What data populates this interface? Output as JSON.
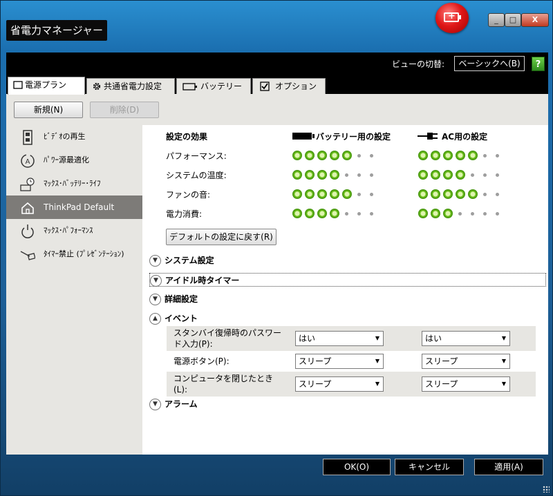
{
  "window": {
    "title": "省電力マネージャー",
    "controls": {
      "minimize": "_",
      "maximize": "□",
      "close": "X"
    }
  },
  "header": {
    "view_label": "ビューの切替:",
    "view_button": "ベーシックへ(B)",
    "help_icon_text": "?"
  },
  "tabs": [
    {
      "label": "電源プラン",
      "icon": "document-icon",
      "active": true
    },
    {
      "label": "共通省電力設定",
      "icon": "gear-icon",
      "active": false
    },
    {
      "label": "バッテリー",
      "icon": "battery-icon",
      "active": false
    },
    {
      "label": "オプション",
      "icon": "checkbox-icon",
      "active": false
    }
  ],
  "toolbar": {
    "new_label": "新規(N)",
    "delete_label": "削除(D)"
  },
  "plans": [
    {
      "label": "ﾋﾞﾃﾞｵの再生",
      "icon": "film-icon",
      "selected": false
    },
    {
      "label": "ﾊﾟﾜｰ源最適化",
      "icon": "power-source-icon",
      "selected": false
    },
    {
      "label": "ﾏｯｸｽ･ﾊﾞｯﾃﾘｰ･ﾗｲﾌ",
      "icon": "battery-timer-icon",
      "selected": false
    },
    {
      "label": "ThinkPad Default",
      "icon": "home-icon",
      "selected": true
    },
    {
      "label": "ﾏｯｸｽ･ﾊﾟﾌｫｰﾏﾝｽ",
      "icon": "power-icon",
      "selected": false
    },
    {
      "label": "ﾀｲﾏｰ禁止 (ﾌﾟﾚｾﾞﾝﾃｰｼｮﾝ)",
      "icon": "projector-icon",
      "selected": false
    }
  ],
  "effects": {
    "header": "設定の効果",
    "battery_header": "バッテリー用の設定",
    "ac_header": "AC用の設定",
    "rows": [
      {
        "label": "パフォーマンス:",
        "battery": 5,
        "ac": 5
      },
      {
        "label": "システムの温度:",
        "battery": 4,
        "ac": 4
      },
      {
        "label": "ファンの音:",
        "battery": 5,
        "ac": 5
      },
      {
        "label": "電力消費:",
        "battery": 4,
        "ac": 3
      }
    ],
    "max_level": 7,
    "reset_button": "デフォルトの設定に戻す(R)"
  },
  "sections": {
    "system": "システム設定",
    "idle": "アイドル時タイマー",
    "advanced": "詳細設定",
    "event": "イベント",
    "alarm": "アラーム"
  },
  "events": [
    {
      "label_line1": "スタンバイ復帰時のパスワー",
      "label_line2": "ド入力(P):",
      "battery": "はい",
      "ac": "はい"
    },
    {
      "label_line1": "電源ボタン(P):",
      "label_line2": "",
      "battery": "スリープ",
      "ac": "スリープ"
    },
    {
      "label_line1": "コンピュータを閉じたとき",
      "label_line2": "(L):",
      "battery": "スリープ",
      "ac": "スリープ"
    }
  ],
  "footer": {
    "ok": "OK(O)",
    "cancel": "キャンセル",
    "apply": "適用(A)"
  }
}
